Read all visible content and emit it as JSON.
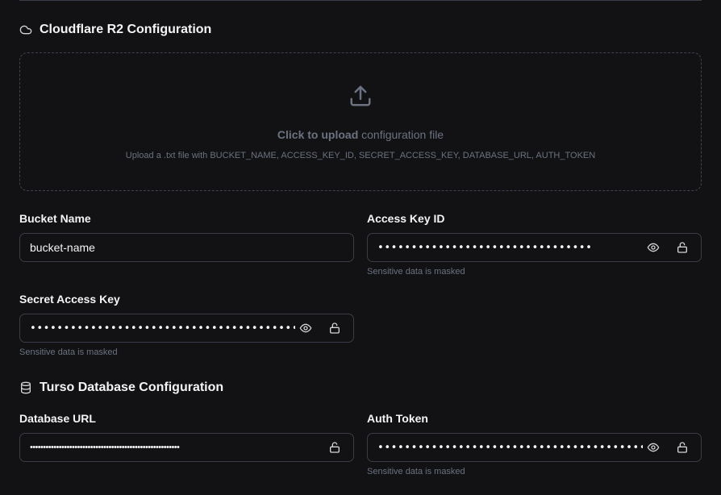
{
  "r2": {
    "title": "Cloudflare R2 Configuration",
    "title_icon": "cloud-icon",
    "upload": {
      "icon": "upload-icon",
      "click_text": "Click to upload",
      "rest_text": " configuration file",
      "sub_text": "Upload a .txt file with BUCKET_NAME, ACCESS_KEY_ID, SECRET_ACCESS_KEY, DATABASE_URL, AUTH_TOKEN"
    },
    "bucket_name": {
      "label": "Bucket Name",
      "value": "bucket-name"
    },
    "access_key_id": {
      "label": "Access Key ID",
      "masked": "••••••••••••••••••••••••••••••••",
      "hint": "Sensitive data is masked"
    },
    "secret_access_key": {
      "label": "Secret Access Key",
      "masked": "••••••••••••••••••••••••••••••••••••••••",
      "hint": "Sensitive data is masked"
    }
  },
  "turso": {
    "title": "Turso Database Configuration",
    "title_icon": "database-icon",
    "database_url": {
      "label": "Database URL",
      "masked": "•••••••••••••••••••••••••••••••••••••••••••••••••••••••••"
    },
    "auth_token": {
      "label": "Auth Token",
      "masked": "••••••••••••••••••••••••••••••••••••••••••••",
      "hint": "Sensitive data is masked"
    }
  },
  "colors": {
    "background": "#121214",
    "border": "#3a3d45",
    "muted_text": "#6b7280",
    "text": "#f4f4f5"
  }
}
